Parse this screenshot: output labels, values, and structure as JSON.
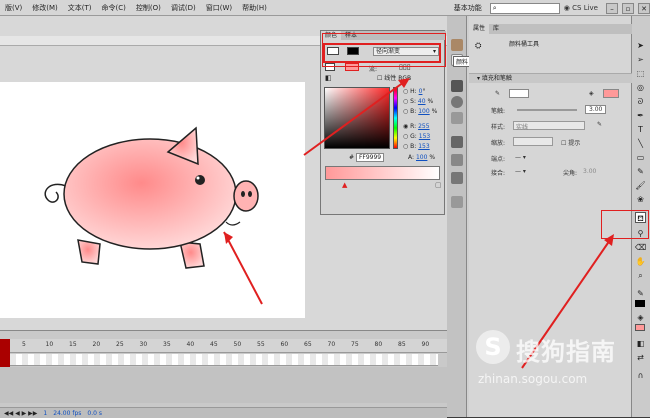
{
  "menubar": {
    "items": [
      "版(V)",
      "修改(M)",
      "文本(T)",
      "命令(C)",
      "控制(O)",
      "调试(D)",
      "窗口(W)",
      "帮助(H)"
    ],
    "workspace": "基本功能",
    "search_placeholder": "",
    "cs_live": "CS Live"
  },
  "stage": {
    "ruler_numbers": []
  },
  "timeline": {
    "frame_numbers": [
      "5",
      "10",
      "15",
      "20",
      "25",
      "30",
      "35",
      "40",
      "45",
      "50",
      "55",
      "60",
      "65",
      "70",
      "75",
      "80",
      "85",
      "90"
    ],
    "status": {
      "frame": "1",
      "fps": "24.00 fps",
      "time": "0.0 s"
    }
  },
  "color_panel": {
    "tabs": [
      "颜色",
      "样本"
    ],
    "fill_type": "径向渐变",
    "flow_label": "流:",
    "linear_label": "线性 RGB",
    "hsb": {
      "h_label": "H:",
      "h": "0",
      "s_label": "S:",
      "s": "40",
      "b_label": "B:",
      "b": "100"
    },
    "rgb": {
      "r_label": "R:",
      "r": "255",
      "g_label": "G:",
      "g": "153",
      "b_label": "B:",
      "b": "153"
    },
    "alpha_label": "A:",
    "alpha": "100",
    "hex": "FF9999",
    "percent": "%",
    "degree": "°"
  },
  "properties": {
    "tabs": [
      "属性",
      "库"
    ],
    "tool_name": "颜料桶工具",
    "section_title": "填充和笔触",
    "stroke_label": "笔触:",
    "stroke_value": "3.00",
    "style_label": "样式:",
    "style_value": "实线",
    "scale_label": "缩放:",
    "hint_label": "提示",
    "cap_label": "端点:",
    "join_label": "接合:",
    "miter_label": "尖角:",
    "miter_value": "3.00"
  },
  "tooltip": "颜料",
  "watermark": {
    "text": "搜狗指南",
    "url": "zhinan.sogou.com"
  },
  "colors": {
    "accent_red": "#e02020",
    "pig_fill": "#ff9999",
    "stage_bg": "#ffffff",
    "link_blue": "#1050c0"
  }
}
